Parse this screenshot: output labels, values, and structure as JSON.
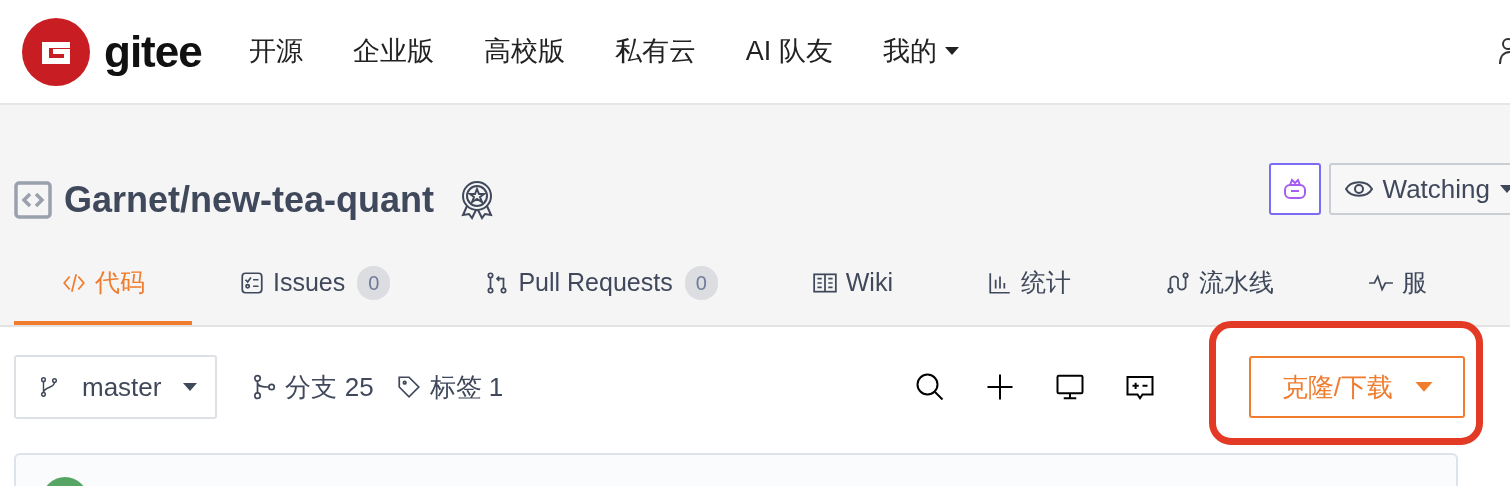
{
  "nav": {
    "logo": "gitee",
    "items": [
      {
        "label": "开源",
        "dropdown": false
      },
      {
        "label": "企业版",
        "dropdown": false
      },
      {
        "label": "高校版",
        "dropdown": false
      },
      {
        "label": "私有云",
        "dropdown": false
      },
      {
        "label": "AI 队友",
        "dropdown": false
      },
      {
        "label": "我的",
        "dropdown": true
      }
    ]
  },
  "repo": {
    "title": "Garnet/new-tea-quant",
    "watch": "Watching"
  },
  "tabs": [
    {
      "kind": "code",
      "label": "代码",
      "selected": true
    },
    {
      "kind": "issues",
      "label": "Issues",
      "count": "0",
      "selected": false
    },
    {
      "kind": "pr",
      "label": "Pull Requests",
      "count": "0",
      "selected": false
    },
    {
      "kind": "wiki",
      "label": "Wiki",
      "selected": false
    },
    {
      "kind": "stats",
      "label": "统计",
      "selected": false
    },
    {
      "kind": "pipeline",
      "label": "流水线",
      "selected": false
    },
    {
      "kind": "service",
      "label": "服",
      "selected": false
    }
  ],
  "toolbar": {
    "branch": "master",
    "branches": "分支 25",
    "tags": "标签 1",
    "clone": "克隆/下载"
  }
}
